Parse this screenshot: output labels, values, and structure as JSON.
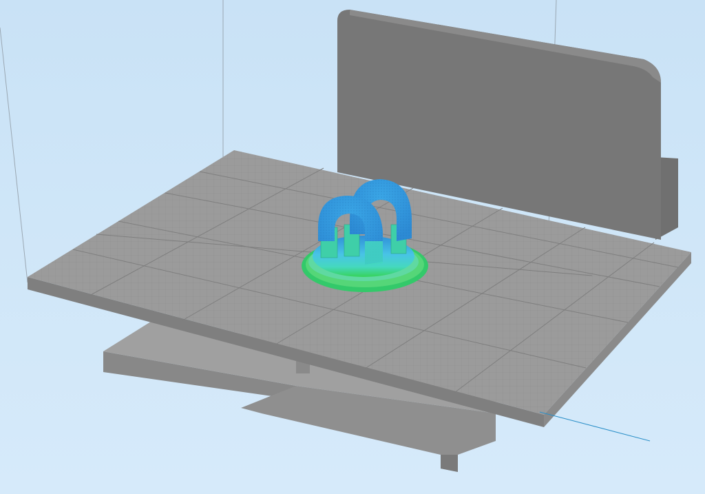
{
  "app": {
    "view": "slicer-3d-preview",
    "background_color": "#cfe6f8",
    "bed_color": "#9a9a9a",
    "grid_color": "#8a8a8a",
    "printer_frame_color": "#7d7d7d",
    "model_top_color": "#3aa0e0",
    "model_mid_color": "#49d6c9",
    "model_base_color": "#39d65a",
    "axis_line_color": "#2a8fc8"
  },
  "scene": {
    "objects": [
      "build-plate",
      "back-panel",
      "carriage-base",
      "printed-model",
      "support-structures",
      "brim"
    ]
  }
}
